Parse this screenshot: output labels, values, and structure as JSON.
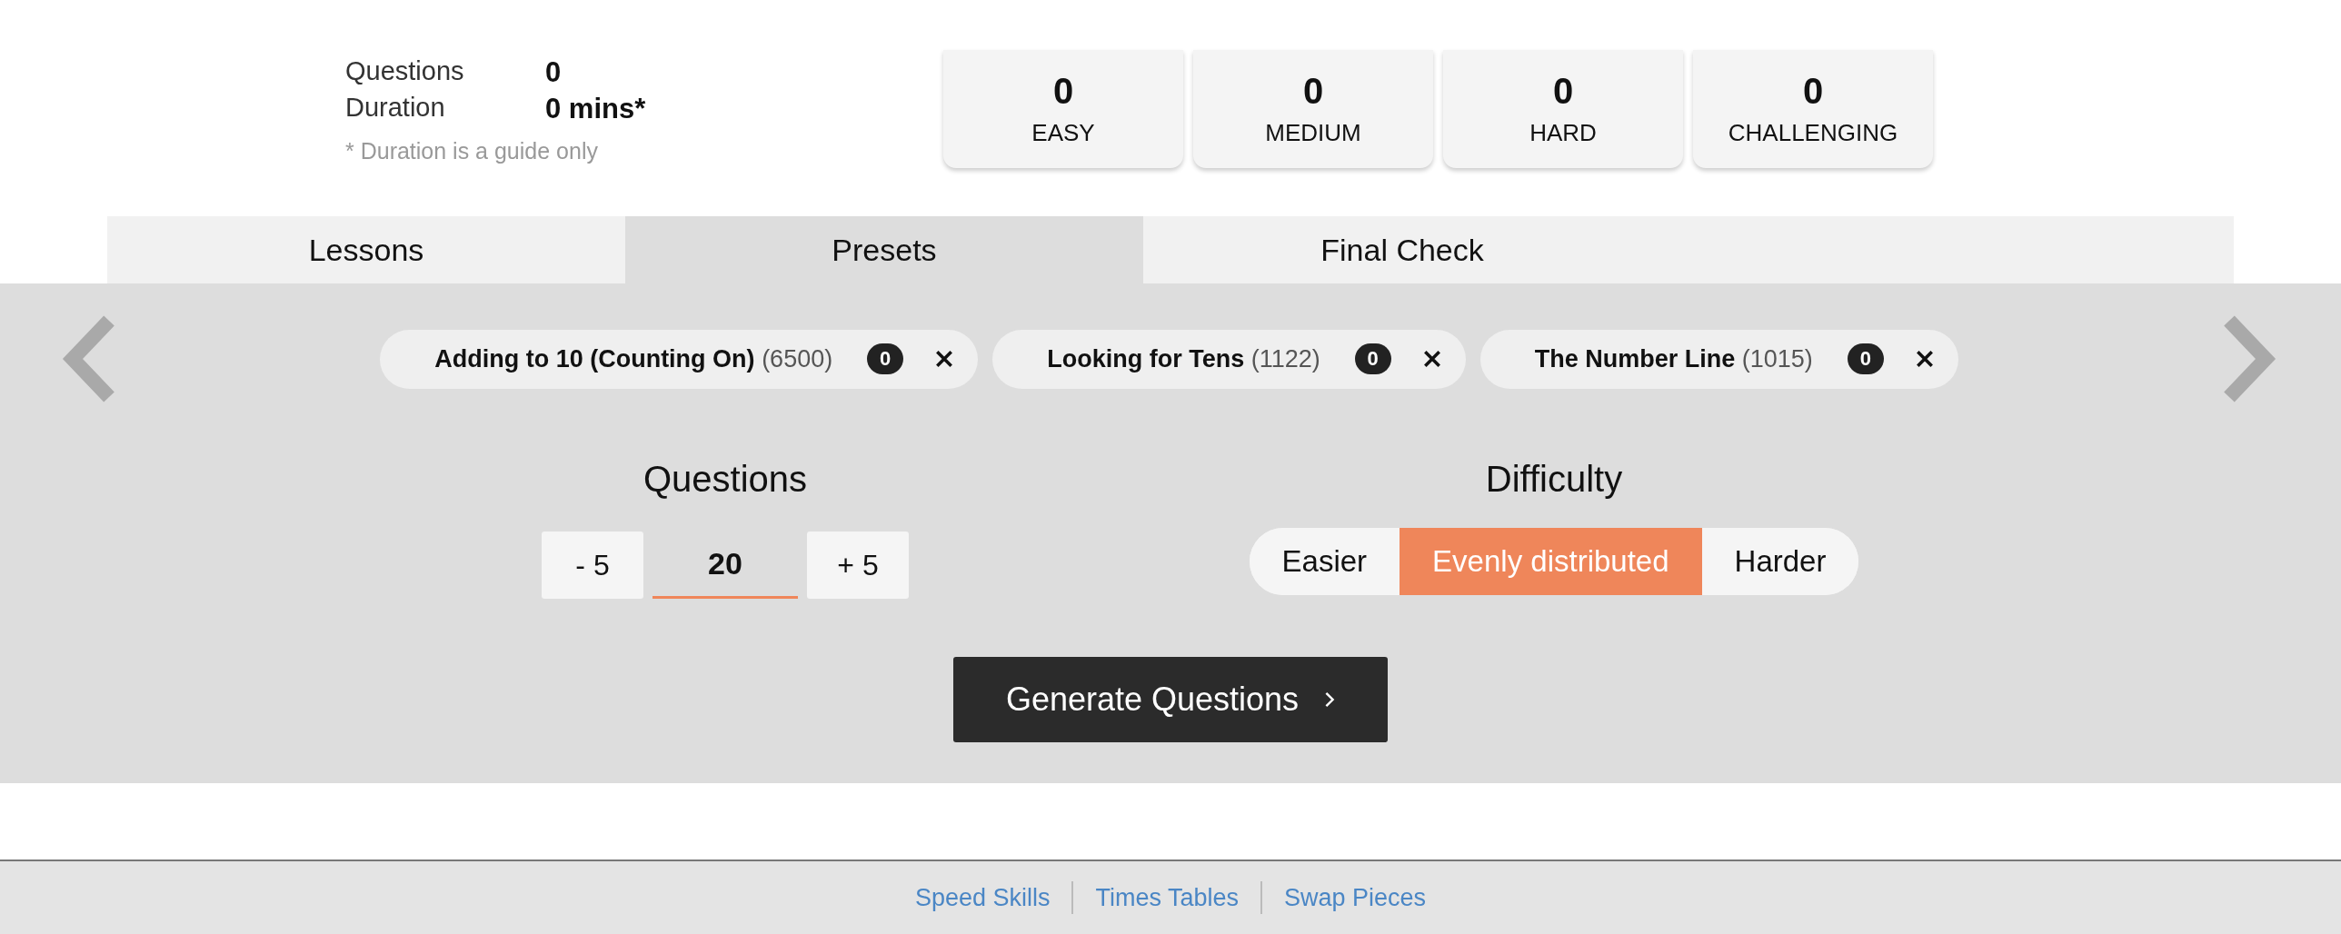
{
  "summary": {
    "rows": [
      {
        "label": "Questions",
        "value": "0"
      },
      {
        "label": "Duration",
        "value": "0 mins*"
      }
    ],
    "note": "* Duration is a guide only"
  },
  "difficulty_counts": [
    {
      "count": "0",
      "label": "EASY"
    },
    {
      "count": "0",
      "label": "MEDIUM"
    },
    {
      "count": "0",
      "label": "HARD"
    },
    {
      "count": "0",
      "label": "CHALLENGING"
    }
  ],
  "tabs": [
    {
      "label": "Lessons",
      "selected": false
    },
    {
      "label": "Presets",
      "selected": true
    },
    {
      "label": "Final Check",
      "selected": false
    }
  ],
  "presets": [
    {
      "name": "Adding to 10 (Counting On)",
      "count": "(6500)",
      "badge": "0"
    },
    {
      "name": "Looking for Tens",
      "count": "(1122)",
      "badge": "0"
    },
    {
      "name": "The Number Line",
      "count": "(1015)",
      "badge": "0"
    }
  ],
  "questions": {
    "heading": "Questions",
    "decrement": "- 5",
    "value": "20",
    "increment": "+ 5"
  },
  "difficulty": {
    "heading": "Difficulty",
    "options": [
      {
        "label": "Easier",
        "selected": false
      },
      {
        "label": "Evenly distributed",
        "selected": true
      },
      {
        "label": "Harder",
        "selected": false
      }
    ]
  },
  "generate_button": {
    "label": "Generate Questions"
  },
  "footer_links": [
    "Speed Skills",
    "Times Tables",
    "Swap Pieces"
  ]
}
